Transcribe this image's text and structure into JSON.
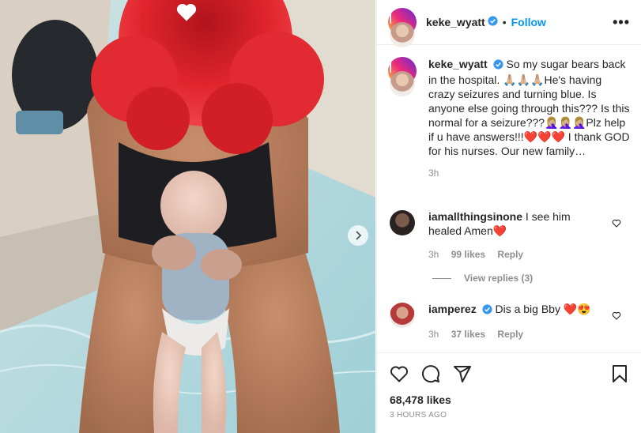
{
  "post": {
    "author": "keke_wyatt",
    "follow_label": "Follow",
    "dot": "•",
    "more_label": "•••",
    "caption_text": "So my sugar bears back in the hospital. 🙏🏼🙏🏼🙏🏼He's having crazy seizures and turning blue. Is anyone else going through this??? Is this normal for a seizure???🤦🏼‍♀️🤦🏼‍♀️🤦🏼‍♀️Plz help if u have answers!!!❤️❤️❤️ I thank GOD for his nurses. Our new family…",
    "caption_time": "3h",
    "likes": "68,478 likes",
    "posted_ago": "3 HOURS AGO"
  },
  "comments": [
    {
      "user": "iamallthingsinone",
      "text": "I see him healed Amen❤️",
      "time": "3h",
      "likes": "99 likes",
      "reply": "Reply",
      "verified": false
    },
    {
      "user": "iamperez",
      "text": "Dis a big Bby ❤️😍",
      "time": "3h",
      "likes": "37 likes",
      "reply": "Reply",
      "verified": true
    }
  ],
  "view_replies": "View replies (3)",
  "icons": {
    "like": "heart-outline-icon",
    "comment": "comment-bubble-icon",
    "share": "paper-plane-icon",
    "save": "bookmark-icon",
    "next": "chevron-right-icon",
    "verified": "verified-badge-icon"
  },
  "colors": {
    "accent": "#0095f6",
    "secondary_text": "#8e8e8e",
    "hair": "#d8242b",
    "pool": "#a9d3da"
  }
}
